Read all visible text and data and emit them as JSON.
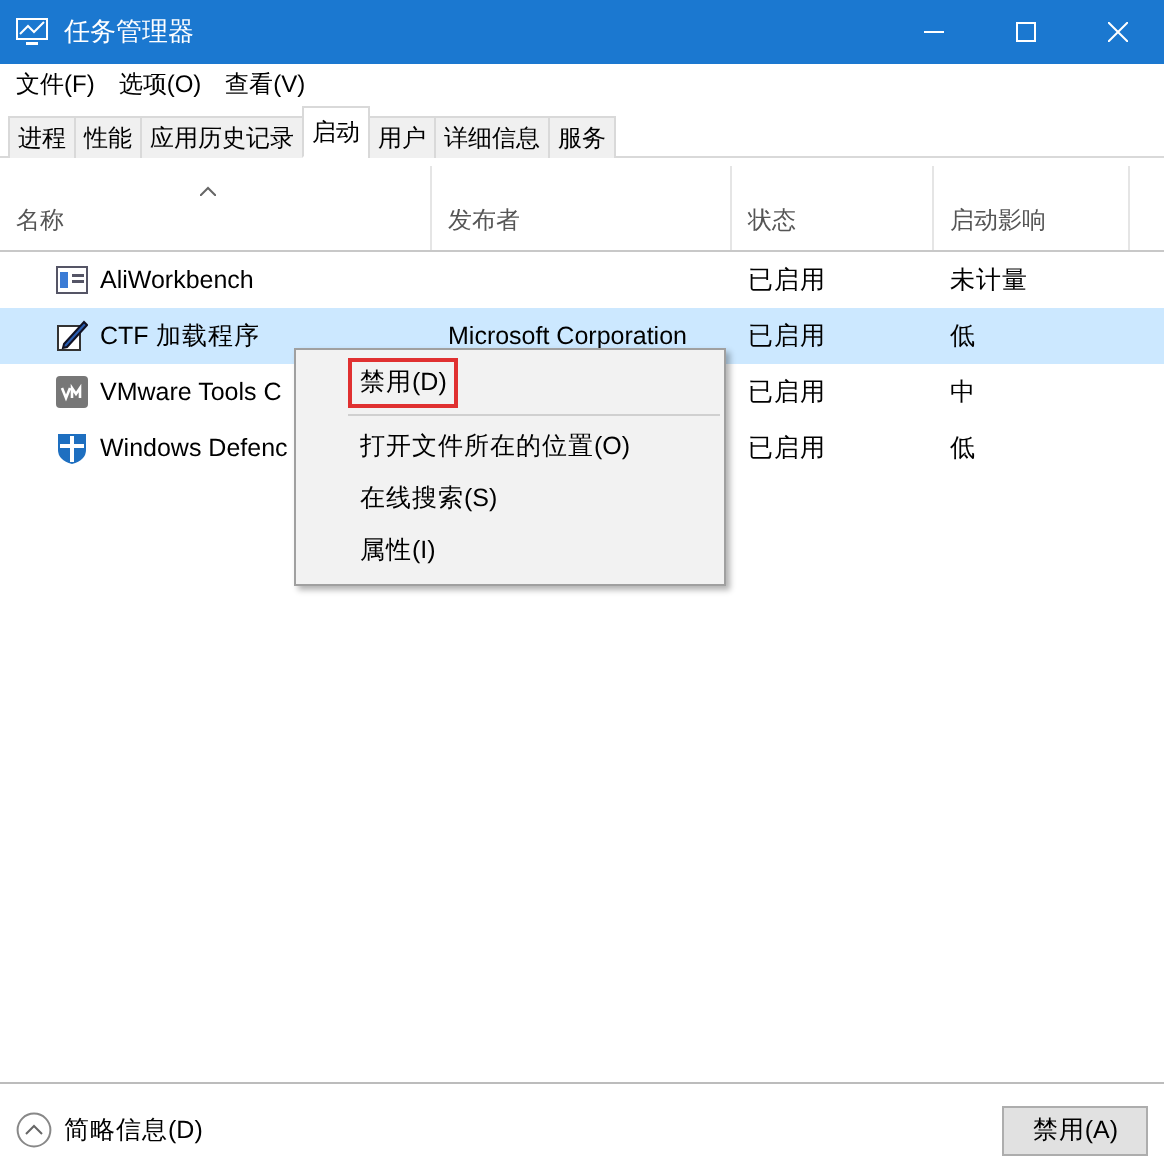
{
  "window": {
    "title": "任务管理器"
  },
  "menu": [
    "文件(F)",
    "选项(O)",
    "查看(V)"
  ],
  "tabs": [
    {
      "label": "进程",
      "selected": false
    },
    {
      "label": "性能",
      "selected": false
    },
    {
      "label": "应用历史记录",
      "selected": false
    },
    {
      "label": "启动",
      "selected": true
    },
    {
      "label": "用户",
      "selected": false
    },
    {
      "label": "详细信息",
      "selected": false
    },
    {
      "label": "服务",
      "selected": false
    }
  ],
  "table": {
    "columns": [
      "名称",
      "发布者",
      "状态",
      "启动影响"
    ],
    "rows": [
      {
        "name": "AliWorkbench",
        "status": "已启用",
        "impact": "未计量",
        "selected": false
      },
      {
        "name": "CTF 加载程序",
        "publisher": "Microsoft Corporation",
        "status": "已启用",
        "impact": "低",
        "selected": true
      },
      {
        "name": "VMware Tools C",
        "status": "已启用",
        "impact": "中",
        "selected": false
      },
      {
        "name": "Windows Defenc",
        "status": "已启用",
        "impact": "低",
        "selected": false
      }
    ]
  },
  "context_menu": [
    {
      "label": "禁用(D)",
      "kind": "item",
      "highlighted": true
    },
    {
      "kind": "separator"
    },
    {
      "label": "打开文件所在的位置(O)",
      "kind": "item",
      "highlighted": false
    },
    {
      "label": "在线搜索(S)",
      "kind": "item",
      "highlighted": false
    },
    {
      "label": "属性(I)",
      "kind": "item",
      "highlighted": false
    }
  ],
  "footer": {
    "toggle": "简略信息(D)",
    "button": "禁用(A)"
  }
}
